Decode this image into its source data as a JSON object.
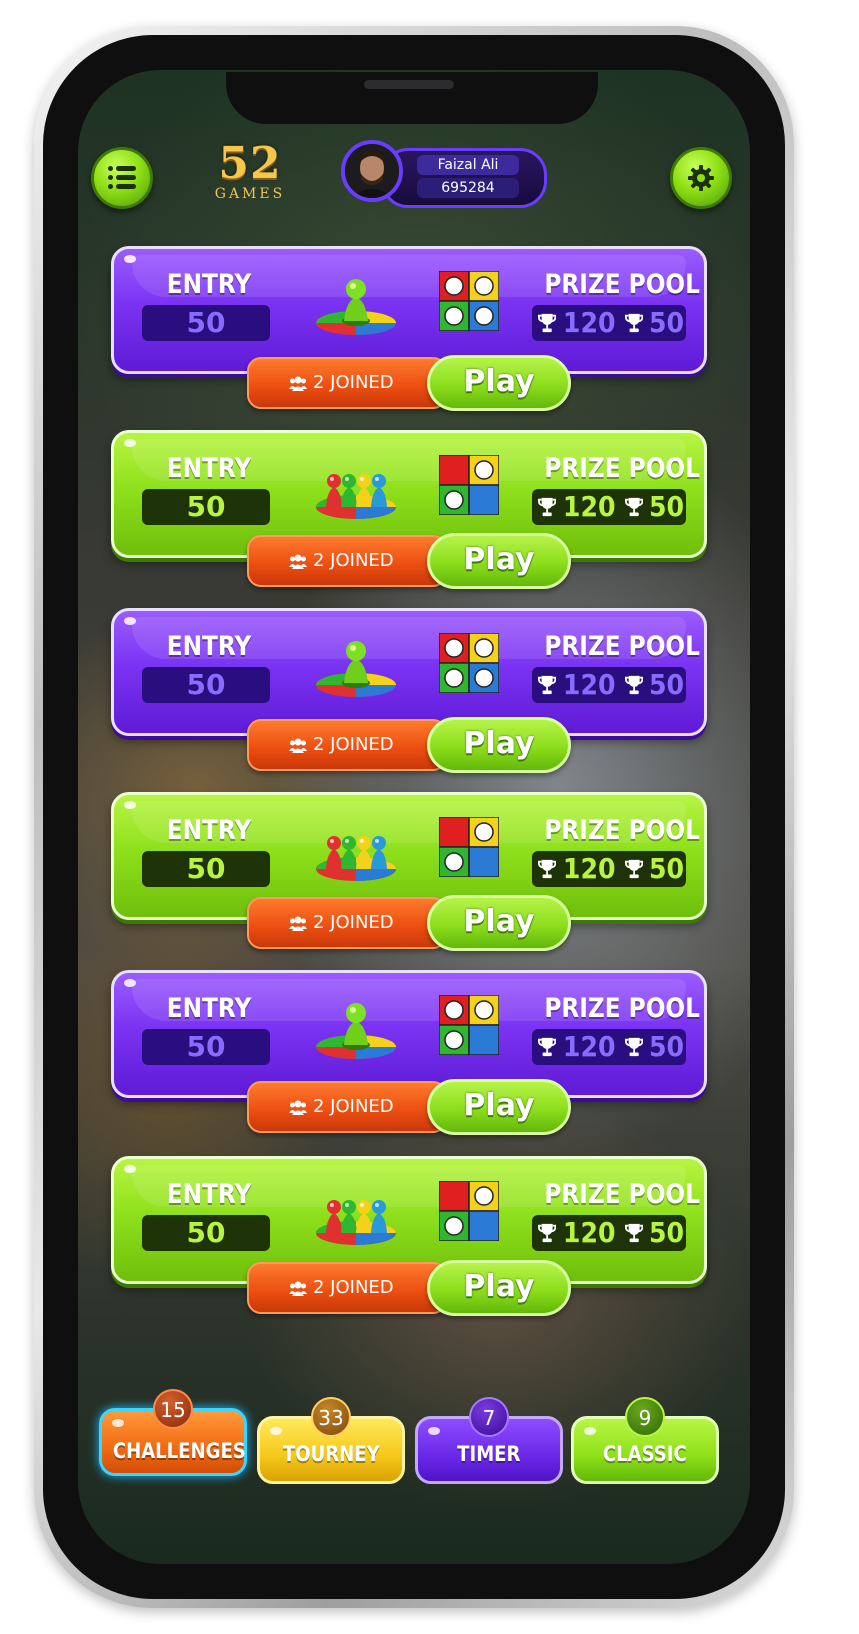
{
  "header": {
    "logo_number": "52",
    "logo_text": "GAMES",
    "user_name": "Faizal Ali",
    "user_coins": "695284"
  },
  "cards": [
    {
      "theme": "purple",
      "entry_label": "ENTRY",
      "entry_value": "50",
      "prize_label": "PRIZE POOL",
      "prize_first": "120",
      "prize_second": "50",
      "joined_text": "2 JOINED",
      "play_label": "Play",
      "players": 4
    },
    {
      "theme": "green",
      "entry_label": "ENTRY",
      "entry_value": "50",
      "prize_label": "PRIZE POOL",
      "prize_first": "120",
      "prize_second": "50",
      "joined_text": "2 JOINED",
      "play_label": "Play",
      "players": 2
    },
    {
      "theme": "purple",
      "entry_label": "ENTRY",
      "entry_value": "50",
      "prize_label": "PRIZE POOL",
      "prize_first": "120",
      "prize_second": "50",
      "joined_text": "2 JOINED",
      "play_label": "Play",
      "players": 4
    },
    {
      "theme": "green",
      "entry_label": "ENTRY",
      "entry_value": "50",
      "prize_label": "PRIZE POOL",
      "prize_first": "120",
      "prize_second": "50",
      "joined_text": "2 JOINED",
      "play_label": "Play",
      "players": 2
    },
    {
      "theme": "purple",
      "entry_label": "ENTRY",
      "entry_value": "50",
      "prize_label": "PRIZE POOL",
      "prize_first": "120",
      "prize_second": "50",
      "joined_text": "2 JOINED",
      "play_label": "Play",
      "players": 3
    },
    {
      "theme": "green",
      "entry_label": "ENTRY",
      "entry_value": "50",
      "prize_label": "PRIZE POOL",
      "prize_first": "120",
      "prize_second": "50",
      "joined_text": "2 JOINED",
      "play_label": "Play",
      "players": 2
    }
  ],
  "tabs": [
    {
      "label": "CHALLENGES",
      "count": "15",
      "color": "#f26a12",
      "active": true
    },
    {
      "label": "TOURNEY",
      "count": "33",
      "color": "#f5c81a",
      "active": false
    },
    {
      "label": "TIMER",
      "count": "7",
      "color": "#6a28e8",
      "active": false
    },
    {
      "label": "CLASSIC",
      "count": "9",
      "color": "#8ee01a",
      "active": false
    }
  ],
  "colors": {
    "purple": "#7a33f2",
    "green": "#8fe01c",
    "orange": "#ea4d10",
    "board_red": "#e02020",
    "board_yellow": "#f5d21a",
    "board_green": "#2fb82f",
    "board_blue": "#2a7ad6"
  },
  "icons": {
    "menu": "menu-list-icon",
    "settings": "gear-icon",
    "trophy": "trophy-icon",
    "joined": "group-icon"
  }
}
